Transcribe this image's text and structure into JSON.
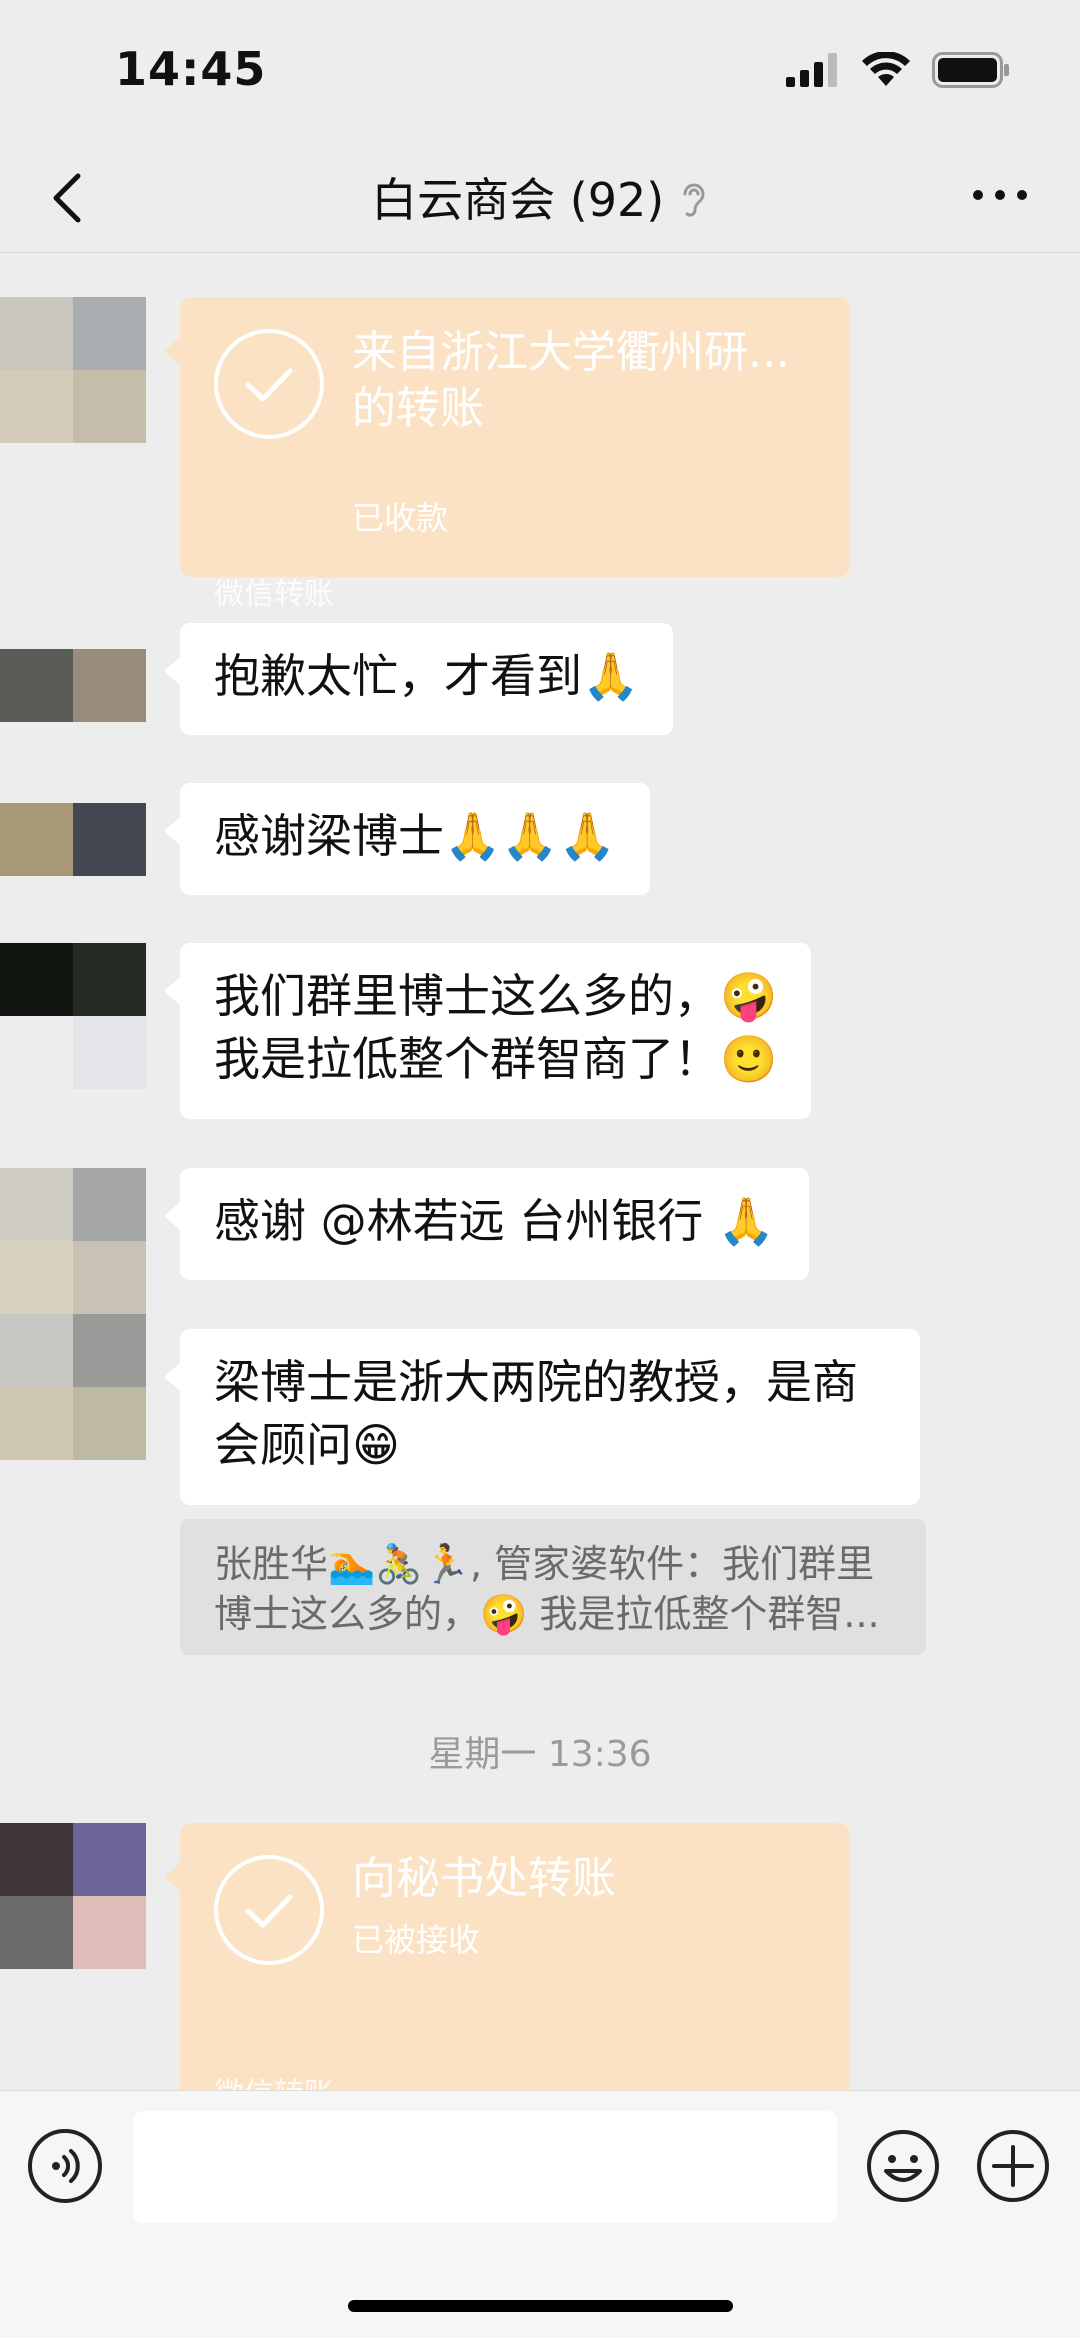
{
  "status_bar": {
    "time": "14:45",
    "signal_icon": "signal-icon",
    "wifi_icon": "wifi-icon",
    "battery_icon": "battery-icon"
  },
  "header": {
    "title": "白云商会 (92)",
    "back_icon": "chevron-left-icon",
    "mute_icon": "ear-icon",
    "more_icon": "more-dots-icon"
  },
  "messages": {
    "m1": {
      "title": "来自浙江大学衢州研...的转账",
      "status": "已收款",
      "footer": "微信转账"
    },
    "m2": {
      "text": "抱歉太忙，才看到🙏"
    },
    "m3": {
      "text": "感谢梁博士🙏🙏🙏"
    },
    "m4": {
      "text": "我们群里博士这么多的，🤪\n我是拉低整个群智商了！🙂"
    },
    "m5": {
      "text": "感谢 @林若远 台州银行 🙏"
    },
    "m6": {
      "text": "梁博士是浙大两院的教授，是商会顾问😁"
    },
    "m6_quote": {
      "text": "张胜华🏊🚴🏃, 管家婆软件：我们群里博士这么多的，🤪 我是拉低整个群智..."
    },
    "timestamp": "星期一 13:36",
    "m7": {
      "title": "向秘书处转账",
      "status": "已被接收",
      "footer": "微信转账"
    }
  },
  "input_bar": {
    "placeholder": "",
    "voice_icon": "voice-icon",
    "emoji_icon": "emoji-icon",
    "plus_icon": "plus-icon"
  },
  "colors": {
    "background": "#ededed",
    "bubble": "#ffffff",
    "transfer": "#fce2c4",
    "quote": "#e0e0e0"
  }
}
